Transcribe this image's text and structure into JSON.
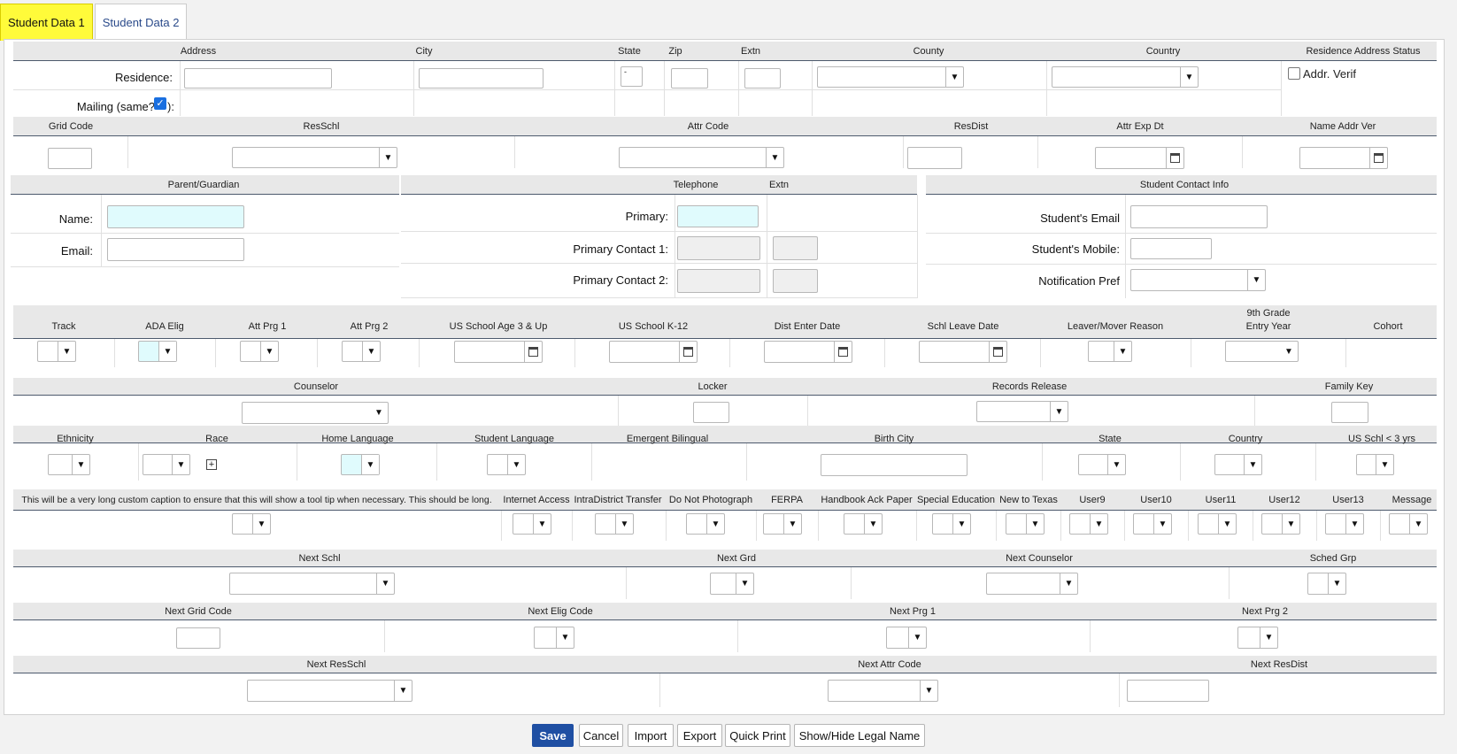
{
  "tabs": [
    "Student Data 1",
    "Student Data 2"
  ],
  "address": {
    "headers": {
      "address": "Address",
      "city": "City",
      "state": "State",
      "zip": "Zip",
      "extn": "Extn",
      "county": "County",
      "country": "Country",
      "status": "Residence Address Status"
    },
    "residence_label": "Residence:",
    "mailing_label": "Mailing (same?",
    "mailing_label_end": "):",
    "addr_verif": "Addr. Verif",
    "state_value": "-"
  },
  "grid": {
    "headers": [
      "Grid Code",
      "ResSchl",
      "Attr Code",
      "ResDist",
      "Attr Exp Dt",
      "Name Addr Ver"
    ]
  },
  "parent": {
    "header": "Parent/Guardian",
    "name_label": "Name:",
    "email_label": "Email:"
  },
  "telephone": {
    "header": "Telephone",
    "extn_header": "Extn",
    "primary": "Primary:",
    "contact1": "Primary Contact 1:",
    "contact2": "Primary Contact 2:"
  },
  "student_contact": {
    "header": "Student Contact Info",
    "email": "Student's Email",
    "mobile": "Student's Mobile:",
    "notif": "Notification Pref"
  },
  "row4": {
    "headers": [
      "Track",
      "ADA Elig",
      "Att Prg 1",
      "Att Prg 2",
      "US School Age 3 & Up",
      "US School K-12",
      "Dist Enter Date",
      "Schl Leave Date",
      "Leaver/Mover Reason",
      "9th Grade",
      "Entry Year",
      "Cohort"
    ]
  },
  "row5": {
    "headers": [
      "Counselor",
      "Locker",
      "Records Release",
      "Family Key"
    ]
  },
  "row6": {
    "headers": [
      "Ethnicity",
      "Race",
      "Home Language",
      "Student Language",
      "Emergent Bilingual",
      "Birth City",
      "State",
      "Country",
      "US Schl < 3 yrs"
    ]
  },
  "row7": {
    "headers": [
      "This will be a very long custom caption to ensure that this will show a tool tip when necessary. This should be long.",
      "Internet Access",
      "IntraDistrict Transfer",
      "Do Not Photograph",
      "FERPA",
      "Handbook Ack Paper",
      "Special Education",
      "New to Texas",
      "User9",
      "User10",
      "User11",
      "User12",
      "User13",
      "Message"
    ]
  },
  "row8": {
    "headers": [
      "Next Schl",
      "Next Grd",
      "Next Counselor",
      "Sched Grp"
    ]
  },
  "row9": {
    "headers": [
      "Next Grid Code",
      "Next Elig Code",
      "Next Prg 1",
      "Next Prg 2"
    ]
  },
  "row10": {
    "headers": [
      "Next ResSchl",
      "Next Attr Code",
      "Next ResDist"
    ]
  },
  "buttons": [
    "Save",
    "Cancel",
    "Import",
    "Export",
    "Quick Print",
    "Show/Hide Legal Name"
  ]
}
